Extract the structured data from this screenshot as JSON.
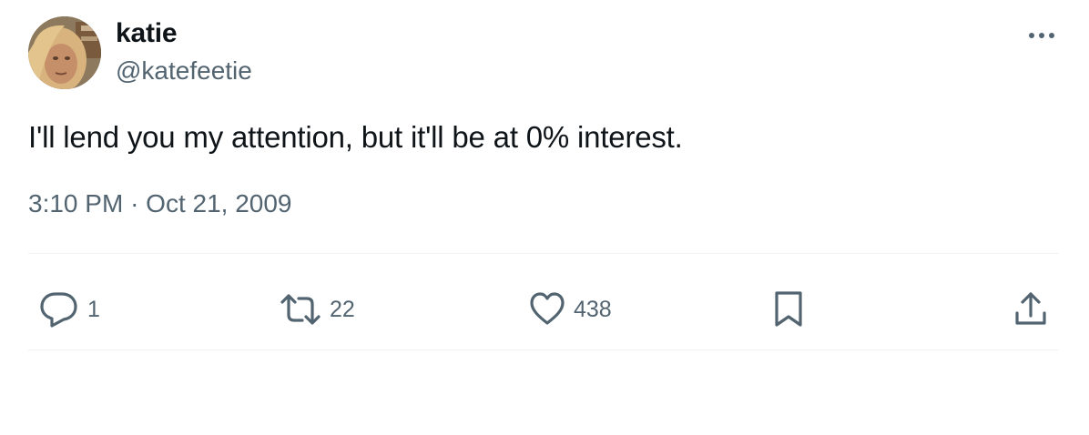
{
  "author": {
    "display_name": "katie",
    "handle": "@katefeetie"
  },
  "tweet": {
    "text": "I'll lend you my attention, but it'll be at 0% interest.",
    "time": "3:10 PM",
    "separator": "·",
    "date": "Oct 21, 2009"
  },
  "actions": {
    "replies": "1",
    "retweets": "22",
    "likes": "438"
  },
  "icons": {
    "more": "more-horizontal-icon",
    "reply": "reply-icon",
    "retweet": "retweet-icon",
    "like": "heart-icon",
    "bookmark": "bookmark-icon",
    "share": "share-icon"
  },
  "colors": {
    "text": "#0f1419",
    "secondary": "#536471",
    "divider": "#eff3f4"
  }
}
